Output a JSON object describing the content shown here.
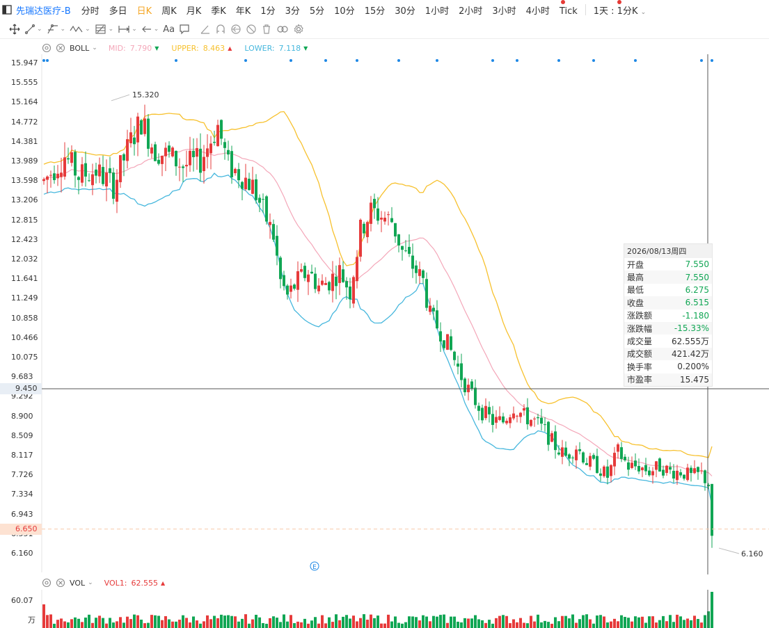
{
  "window": {
    "ticker": "先瑞达医疗-B",
    "periods": [
      {
        "label": "分时",
        "active": false
      },
      {
        "label": "多日",
        "active": false
      },
      {
        "label": "日K",
        "active": true
      },
      {
        "label": "周K",
        "active": false
      },
      {
        "label": "月K",
        "active": false
      },
      {
        "label": "季K",
        "active": false
      },
      {
        "label": "年K",
        "active": false
      },
      {
        "label": "1分",
        "active": false
      },
      {
        "label": "3分",
        "active": false
      },
      {
        "label": "5分",
        "active": false
      },
      {
        "label": "10分",
        "active": false
      },
      {
        "label": "15分",
        "active": false
      },
      {
        "label": "30分",
        "active": false
      },
      {
        "label": "1小时",
        "active": false
      },
      {
        "label": "2小时",
        "active": false
      },
      {
        "label": "3小时",
        "active": false
      },
      {
        "label": "4小时",
        "active": false
      },
      {
        "label": "Tick",
        "active": false
      }
    ],
    "multi_period": "1天 : 1分K"
  },
  "toolbar": {
    "text_tool_label": "Aa",
    "icons": [
      "crosshair-icon",
      "line-icon",
      "channel-icon",
      "wave-icon",
      "fib-icon",
      "measure-icon",
      "arrow-icon",
      "text-icon",
      "comment-icon",
      "ruler-icon",
      "magnet-icon",
      "eye-icon",
      "hide-icon",
      "trash-icon",
      "link-icon",
      "settings-icon"
    ]
  },
  "boll_legend": {
    "name": "BOLL",
    "mid_label": "MID:",
    "mid_value": "7.790",
    "upper_label": "UPPER:",
    "upper_value": "8.463",
    "lower_label": "LOWER:",
    "lower_value": "7.118"
  },
  "vol_legend": {
    "name": "VOL",
    "vol1_label": "VOL1:",
    "vol1_value": "62.555"
  },
  "colors": {
    "up": "#e63b3b",
    "down": "#11a654",
    "mid": "#f4a7b9",
    "upper": "#f7c12e",
    "lower": "#46b7dd",
    "crosshair": "#555555",
    "marker": "#1e88e5"
  },
  "price_axis": {
    "labels": [
      "15.947",
      "15.555",
      "15.164",
      "14.772",
      "14.381",
      "13.989",
      "13.598",
      "13.206",
      "12.815",
      "12.423",
      "12.032",
      "11.641",
      "11.249",
      "10.858",
      "10.466",
      "10.075",
      "9.683",
      "9.292",
      "8.900",
      "8.509",
      "8.117",
      "7.726",
      "7.334",
      "6.943",
      "6.551",
      "6.160"
    ],
    "crosshair_price": "9.450",
    "last_price": "6.650"
  },
  "vol_axis": {
    "top_label": "60.07",
    "unit": "万"
  },
  "annotations": {
    "high_label": "15.320",
    "low_label": "6.160",
    "event_marker": "E"
  },
  "info": {
    "date": "2026/08/13周四",
    "rows": [
      {
        "label": "开盘",
        "value": "7.550",
        "dir": "down"
      },
      {
        "label": "最高",
        "value": "7.550",
        "dir": "down"
      },
      {
        "label": "最低",
        "value": "6.275",
        "dir": "down"
      },
      {
        "label": "收盘",
        "value": "6.515",
        "dir": "down"
      },
      {
        "label": "涨跌额",
        "value": "-1.180",
        "dir": "down"
      },
      {
        "label": "涨跌幅",
        "value": "-15.33%",
        "dir": "down"
      },
      {
        "label": "成交量",
        "value": "62.555万",
        "dir": ""
      },
      {
        "label": "成交额",
        "value": "421.42万",
        "dir": ""
      },
      {
        "label": "换手率",
        "value": "0.200%",
        "dir": ""
      },
      {
        "label": "市盈率",
        "value": "15.475",
        "dir": ""
      }
    ]
  },
  "chart_data": {
    "type": "candlestick",
    "price_range": [
      6.16,
      15.947
    ],
    "anchors": [
      [
        0,
        13.6
      ],
      [
        6,
        14.1
      ],
      [
        10,
        13.7
      ],
      [
        15,
        13.8
      ],
      [
        20,
        13.5
      ],
      [
        25,
        14.4
      ],
      [
        28,
        14.8
      ],
      [
        32,
        14.2
      ],
      [
        36,
        14.1
      ],
      [
        40,
        13.9
      ],
      [
        45,
        14.0
      ],
      [
        50,
        14.7
      ],
      [
        53,
        13.9
      ],
      [
        57,
        13.7
      ],
      [
        60,
        13.5
      ],
      [
        63,
        13.0
      ],
      [
        66,
        12.5
      ],
      [
        68,
        11.6
      ],
      [
        70,
        11.3
      ],
      [
        73,
        11.6
      ],
      [
        76,
        11.8
      ],
      [
        79,
        11.5
      ],
      [
        82,
        11.6
      ],
      [
        85,
        11.8
      ],
      [
        88,
        11.4
      ],
      [
        91,
        12.6
      ],
      [
        94,
        13.0
      ],
      [
        97,
        12.9
      ],
      [
        100,
        12.8
      ],
      [
        103,
        12.2
      ],
      [
        106,
        11.9
      ],
      [
        109,
        11.6
      ],
      [
        111,
        10.9
      ],
      [
        114,
        10.6
      ],
      [
        117,
        10.2
      ],
      [
        120,
        9.7
      ],
      [
        123,
        9.3
      ],
      [
        126,
        9.0
      ],
      [
        129,
        8.8
      ],
      [
        132,
        8.8
      ],
      [
        135,
        9.1
      ],
      [
        138,
        8.9
      ],
      [
        141,
        8.8
      ],
      [
        144,
        8.6
      ],
      [
        147,
        8.3
      ],
      [
        150,
        8.1
      ],
      [
        153,
        8.3
      ],
      [
        156,
        8.0
      ],
      [
        159,
        7.9
      ],
      [
        162,
        7.7
      ],
      [
        165,
        8.2
      ],
      [
        168,
        7.9
      ],
      [
        171,
        7.9
      ],
      [
        174,
        7.8
      ],
      [
        177,
        7.9
      ],
      [
        180,
        7.8
      ],
      [
        183,
        7.8
      ],
      [
        186,
        7.7
      ],
      [
        189,
        7.75
      ],
      [
        191,
        7.55
      ],
      [
        192,
        6.65
      ]
    ],
    "last_candle": {
      "open": 7.55,
      "high": 7.55,
      "low": 6.275,
      "close": 6.515
    }
  }
}
